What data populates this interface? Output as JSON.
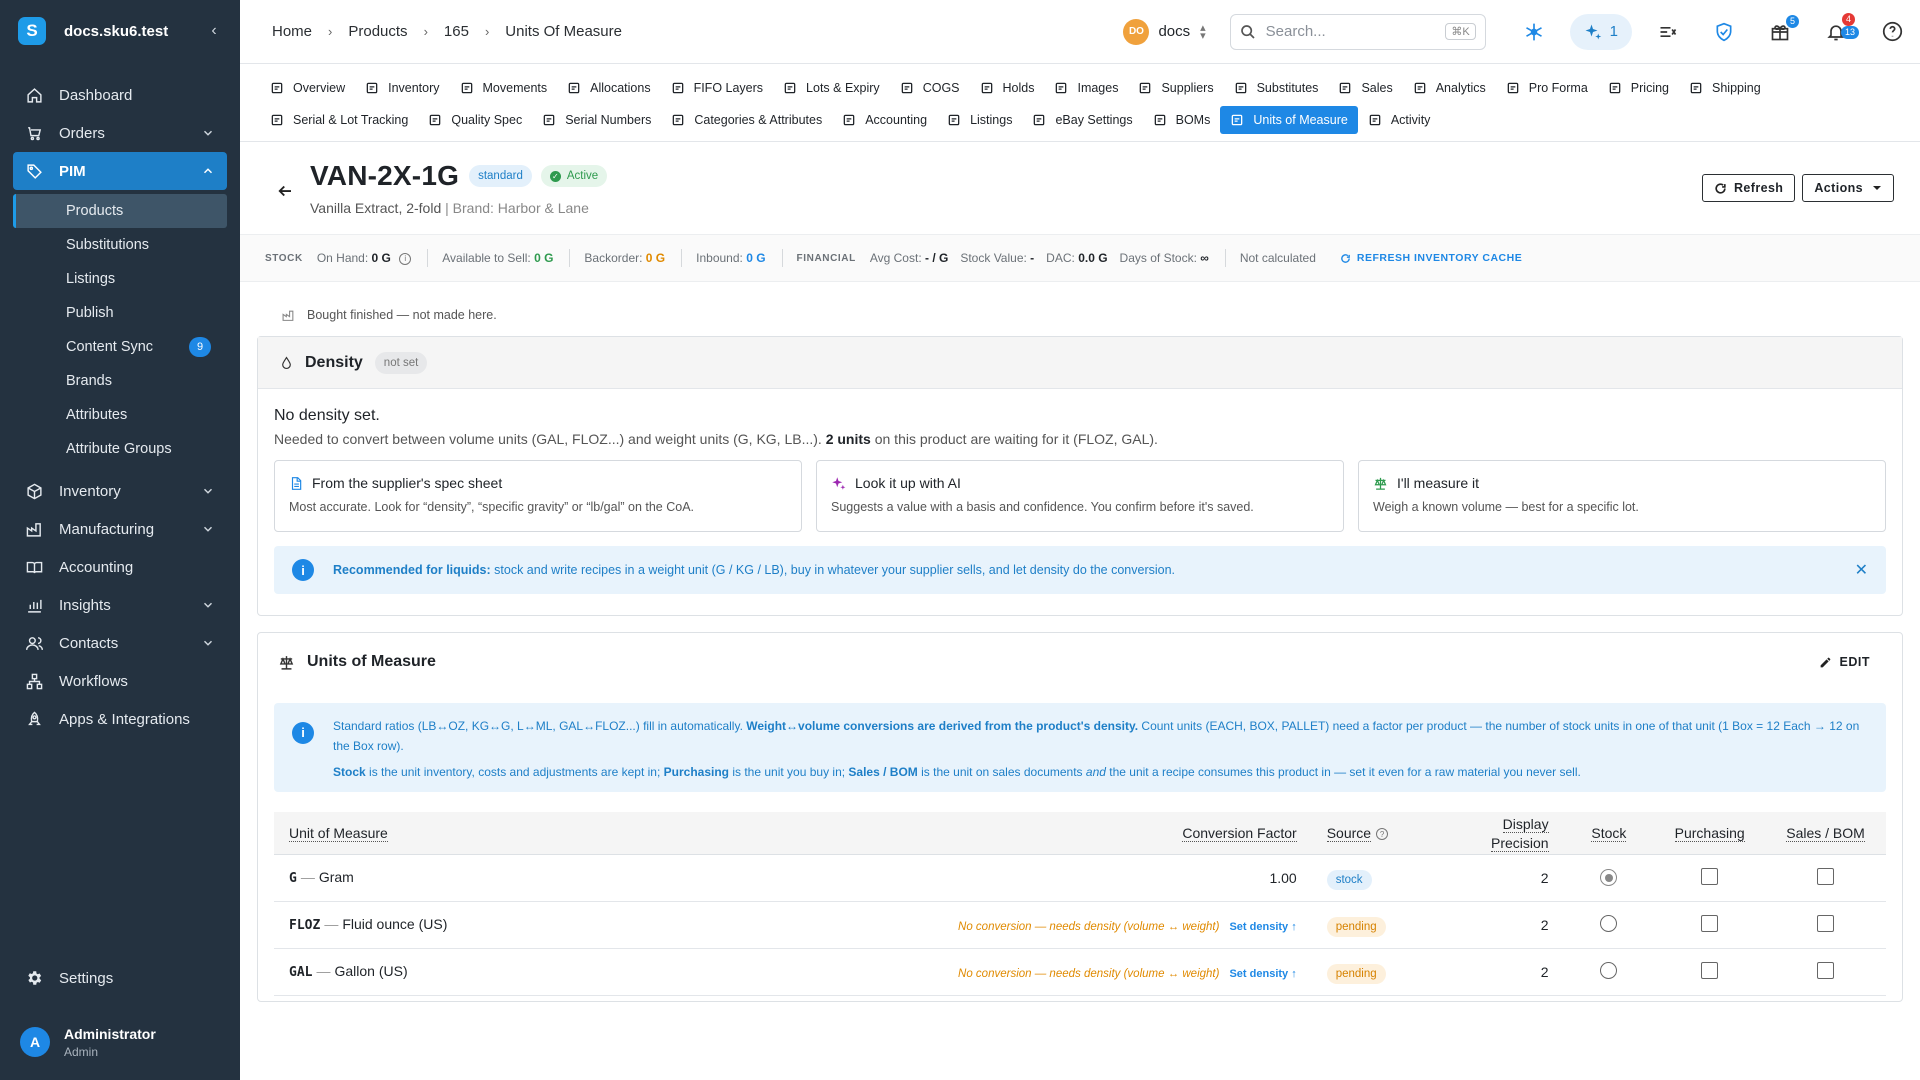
{
  "app": {
    "name": "docs.sku6.test",
    "logo_letter": "S"
  },
  "sidebar": {
    "items": [
      {
        "label": "Dashboard",
        "icon": "home-icon"
      },
      {
        "label": "Orders",
        "icon": "cart-icon"
      },
      {
        "label": "PIM",
        "icon": "tag-icon"
      },
      {
        "label": "Inventory",
        "icon": "box-icon"
      },
      {
        "label": "Manufacturing",
        "icon": "factory-icon"
      },
      {
        "label": "Accounting",
        "icon": "book-icon"
      },
      {
        "label": "Insights",
        "icon": "chart-icon"
      },
      {
        "label": "Contacts",
        "icon": "people-icon"
      },
      {
        "label": "Workflows",
        "icon": "workflow-icon"
      },
      {
        "label": "Apps & Integrations",
        "icon": "rocket-icon"
      }
    ],
    "pim_sub": [
      {
        "label": "Products"
      },
      {
        "label": "Substitutions"
      },
      {
        "label": "Listings"
      },
      {
        "label": "Publish"
      },
      {
        "label": "Content Sync",
        "badge": "9"
      },
      {
        "label": "Brands"
      },
      {
        "label": "Attributes"
      },
      {
        "label": "Attribute Groups"
      }
    ],
    "settings": "Settings",
    "user": {
      "name": "Administrator",
      "role": "Admin",
      "initial": "A"
    }
  },
  "topbar": {
    "breadcrumbs": [
      "Home",
      "Products",
      "165",
      "Units Of Measure"
    ],
    "org": {
      "initials": "DO",
      "name": "docs"
    },
    "search": {
      "placeholder": "Search...",
      "shortcut": "⌘K"
    },
    "ai_count": "1",
    "gift_badge": "5",
    "notif_badge_top": "4",
    "notif_badge_bottom": "13"
  },
  "tabs": {
    "row1": [
      "Overview",
      "Inventory",
      "Movements",
      "Allocations",
      "FIFO Layers",
      "Lots & Expiry",
      "COGS",
      "Holds",
      "Images",
      "Suppliers",
      "Substitutes",
      "Sales",
      "Analytics",
      "Pro Forma",
      "Pricing",
      "Shipping"
    ],
    "row2": [
      "Serial & Lot Tracking",
      "Quality Spec",
      "Serial Numbers",
      "Categories & Attributes",
      "Accounting",
      "Listings",
      "eBay Settings",
      "BOMs",
      "Units of Measure",
      "Activity"
    ],
    "active": "Units of Measure"
  },
  "product": {
    "sku": "VAN-2X-1G",
    "type_chip": "standard",
    "status_chip": "Active",
    "name": "Vanilla Extract, 2-fold",
    "brand": "Brand: Harbor & Lane",
    "refresh_label": "Refresh",
    "actions_label": "Actions"
  },
  "stockbar": {
    "stock_cap": "STOCK",
    "on_hand_label": "On Hand:",
    "on_hand": "0 G",
    "available_label": "Available to Sell:",
    "available": "0 G",
    "backorder_label": "Backorder:",
    "backorder": "0 G",
    "inbound_label": "Inbound:",
    "inbound": "0 G",
    "financial_cap": "FINANCIAL",
    "avg_cost_label": "Avg Cost:",
    "avg_cost": "- / G",
    "stock_value_label": "Stock Value:",
    "stock_value": "-",
    "dac_label": "DAC:",
    "dac": "0.0 G",
    "days_label": "Days of Stock:",
    "days": "∞",
    "not_calc": "Not calculated",
    "refresh_cache": "REFRESH INVENTORY CACHE"
  },
  "bought_note": "Bought finished — not made here.",
  "density": {
    "title": "Density",
    "chip": "not set",
    "heading": "No density set.",
    "needed_pre": "Needed to convert between volume units (GAL, FLOZ...) and weight units (G, KG, LB...).",
    "needed_bold": "2 units",
    "needed_post": "on this product are waiting for it (FLOZ, GAL).",
    "options": [
      {
        "title": "From the supplier's spec sheet",
        "desc": "Most accurate. Look for “density”, “specific gravity” or “lb/gal” on the CoA.",
        "icon": "document-icon"
      },
      {
        "title": "Look it up with AI",
        "desc": "Suggests a value with a basis and confidence. You confirm before it's saved.",
        "icon": "sparkle-icon"
      },
      {
        "title": "I'll measure it",
        "desc": "Weigh a known volume — best for a specific lot.",
        "icon": "scale-icon"
      }
    ],
    "info_bold": "Recommended for liquids:",
    "info_text": "stock and write recipes in a weight unit (G / KG / LB), buy in whatever your supplier sells, and let density do the conversion."
  },
  "uom": {
    "title": "Units of Measure",
    "edit_label": "EDIT",
    "info_p1_a": "Standard ratios (LB↔OZ, KG↔G, L↔ML, GAL↔FLOZ...) fill in automatically.",
    "info_p1_b": "Weight↔volume conversions are derived from the product's density.",
    "info_p1_c": "Count units (EACH, BOX, PALLET) need a factor per product — the number of stock units in one of that unit (1 Box = 12 Each → 12 on the Box row).",
    "info_p2_stock": "Stock",
    "info_p2_a": "is the unit inventory, costs and adjustments are kept in;",
    "info_p2_purch": "Purchasing",
    "info_p2_b": "is the unit you buy in;",
    "info_p2_sales": "Sales / BOM",
    "info_p2_c": "is the unit on sales documents",
    "info_p2_and": "and",
    "info_p2_d": "the unit a recipe consumes this product in — set it even for a raw material you never sell.",
    "columns": {
      "unit": "Unit of Measure",
      "factor": "Conversion Factor",
      "source": "Source",
      "precision_1": "Display",
      "precision_2": "Precision",
      "stock": "Stock",
      "purchasing": "Purchasing",
      "sales": "Sales / BOM"
    },
    "rows": [
      {
        "code": "G",
        "name": "Gram",
        "factor": "1.00",
        "source": "stock",
        "precision": "2",
        "stock": true,
        "purchasing": false,
        "sales": false
      },
      {
        "code": "FLOZ",
        "name": "Fluid ounce (US)",
        "factor_note": "No conversion — needs density (volume ↔ weight)",
        "set_link": "Set density ↑",
        "source": "pending",
        "precision": "2",
        "stock": false,
        "purchasing": false,
        "sales": false
      },
      {
        "code": "GAL",
        "name": "Gallon (US)",
        "factor_note": "No conversion — needs density (volume ↔ weight)",
        "set_link": "Set density ↑",
        "source": "pending",
        "precision": "2",
        "stock": false,
        "purchasing": false,
        "sales": false
      }
    ]
  },
  "colors": {
    "sidebar_bg": "#243240",
    "accent": "#1e88e5",
    "success": "#2e9a4e",
    "warning": "#e08a00"
  }
}
